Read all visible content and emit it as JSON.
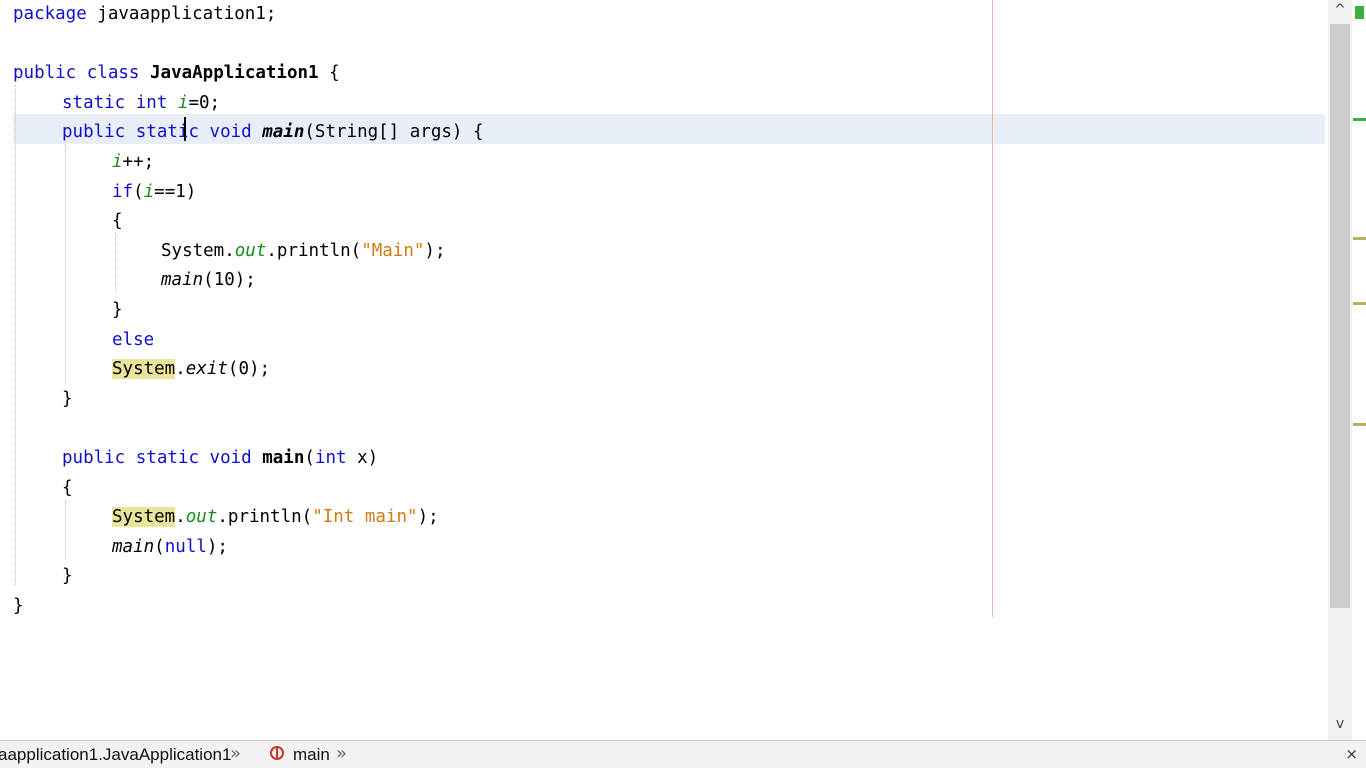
{
  "editor": {
    "lines": [
      {
        "t": [
          {
            "c": "kw",
            "v": "package"
          },
          {
            "v": " javaapplication1;"
          }
        ]
      },
      {
        "t": []
      },
      {
        "t": [
          {
            "c": "kw",
            "v": "public"
          },
          {
            "v": " "
          },
          {
            "c": "kw",
            "v": "class"
          },
          {
            "v": " "
          },
          {
            "c": "mth",
            "v": "JavaApplication1"
          },
          {
            "v": " {"
          }
        ]
      },
      {
        "t": [
          {
            "v": "    "
          },
          {
            "c": "kw",
            "v": "static"
          },
          {
            "v": " "
          },
          {
            "c": "kw",
            "v": "int"
          },
          {
            "v": " "
          },
          {
            "c": "fld",
            "v": "i"
          },
          {
            "v": "=0;"
          }
        ]
      },
      {
        "t": [
          {
            "v": "    "
          },
          {
            "c": "kw",
            "v": "public"
          },
          {
            "v": " "
          },
          {
            "c": "kw",
            "v": "static"
          },
          {
            "v": " "
          },
          {
            "c": "kw",
            "v": "void"
          },
          {
            "v": " "
          },
          {
            "c": "mth-i",
            "v": "main"
          },
          {
            "v": "(String[] args) {"
          }
        ]
      },
      {
        "t": [
          {
            "v": "        "
          },
          {
            "c": "fld",
            "v": "i"
          },
          {
            "v": "++;"
          }
        ]
      },
      {
        "t": [
          {
            "v": "        "
          },
          {
            "c": "kw",
            "v": "if"
          },
          {
            "v": "("
          },
          {
            "c": "fld",
            "v": "i"
          },
          {
            "v": "==1)"
          }
        ]
      },
      {
        "t": [
          {
            "v": "        {"
          }
        ]
      },
      {
        "t": [
          {
            "v": "            System."
          },
          {
            "c": "fld",
            "v": "out"
          },
          {
            "v": ".println("
          },
          {
            "c": "str",
            "v": "\"Main\""
          },
          {
            "v": ");"
          }
        ]
      },
      {
        "t": [
          {
            "v": "            "
          },
          {
            "c": "ital",
            "v": "main"
          },
          {
            "v": "(10);"
          }
        ]
      },
      {
        "t": [
          {
            "v": "        }"
          }
        ]
      },
      {
        "t": [
          {
            "v": "        "
          },
          {
            "c": "kw",
            "v": "else"
          }
        ]
      },
      {
        "t": [
          {
            "v": "        "
          },
          {
            "c": "occ",
            "v": "System"
          },
          {
            "v": "."
          },
          {
            "c": "ital",
            "v": "exit"
          },
          {
            "v": "(0);"
          }
        ]
      },
      {
        "t": [
          {
            "v": "    }"
          }
        ]
      },
      {
        "t": []
      },
      {
        "t": [
          {
            "v": "    "
          },
          {
            "c": "kw",
            "v": "public"
          },
          {
            "v": " "
          },
          {
            "c": "kw",
            "v": "static"
          },
          {
            "v": " "
          },
          {
            "c": "kw",
            "v": "void"
          },
          {
            "v": " "
          },
          {
            "c": "mth",
            "v": "main"
          },
          {
            "v": "("
          },
          {
            "c": "kw",
            "v": "int"
          },
          {
            "v": " x)"
          }
        ]
      },
      {
        "t": [
          {
            "v": "    {"
          }
        ]
      },
      {
        "t": [
          {
            "v": "        "
          },
          {
            "c": "occ",
            "v": "System"
          },
          {
            "v": "."
          },
          {
            "c": "fld",
            "v": "out"
          },
          {
            "v": ".println("
          },
          {
            "c": "str",
            "v": "\"Int main\""
          },
          {
            "v": ");"
          }
        ]
      },
      {
        "t": [
          {
            "v": "        "
          },
          {
            "c": "ital",
            "v": "main"
          },
          {
            "v": "("
          },
          {
            "c": "kw",
            "v": "null"
          },
          {
            "v": ");"
          }
        ]
      },
      {
        "t": [
          {
            "v": "    }"
          }
        ]
      },
      {
        "t": [
          {
            "v": "}"
          }
        ]
      }
    ]
  },
  "scrollbar": {
    "up_icon": "chevron-up-icon",
    "down_icon": "chevron-down-icon",
    "up_glyph": "^",
    "down_glyph": "v"
  },
  "navbar": {
    "class_path": "aapplication1.JavaApplication1",
    "method": "main",
    "separator_glyph": "»",
    "close_glyph": "×"
  },
  "colors": {
    "keyword": "#1010c8",
    "field": "#1a8a1a",
    "string": "#d07a10",
    "occurrence": "#e8e49a",
    "current_line": "#e8eef8"
  }
}
